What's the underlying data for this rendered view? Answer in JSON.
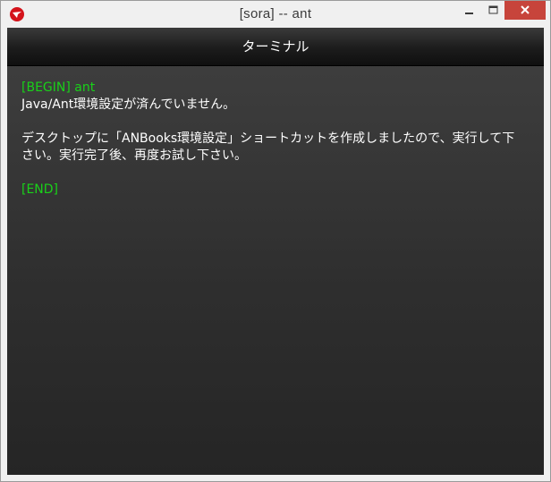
{
  "window": {
    "title": "[sora] -- ant",
    "icon": "app-logo-icon",
    "controls": [
      "minimize-icon",
      "maximize-icon",
      "close-icon"
    ]
  },
  "header": {
    "title": "ターミナル"
  },
  "terminal": {
    "begin": "[BEGIN] ant",
    "line1": "Java/Ant環境設定が済んでいません。",
    "line2": "デスクトップに「ANBooks環境設定」ショートカットを作成しましたので、実行して下さい。実行完了後、再度お試し下さい。",
    "end": "[END]"
  },
  "colors": {
    "accent_green": "#19d119",
    "close_button": "#c7443b",
    "app_icon": "#d4131b"
  }
}
